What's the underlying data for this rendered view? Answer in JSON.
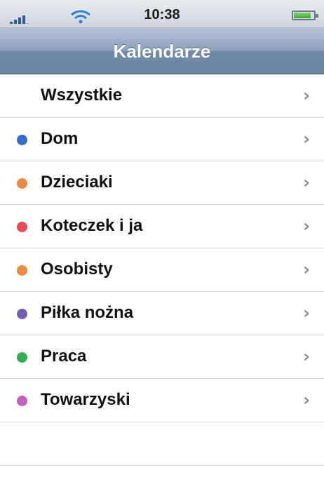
{
  "status_bar": {
    "time": "10:38",
    "signal_icon": "signal-bars-icon",
    "wifi_icon": "wifi-icon",
    "battery_icon": "battery-icon",
    "battery_color": "#4cb83a"
  },
  "nav_bar": {
    "title": "Kalendarze"
  },
  "calendars": [
    {
      "label": "Wszystkie",
      "color": null
    },
    {
      "label": "Dom",
      "color": "#2f6fd0"
    },
    {
      "label": "Dzieciaki",
      "color": "#f08a3c"
    },
    {
      "label": "Koteczek i ja",
      "color": "#e84b55"
    },
    {
      "label": "Osobisty",
      "color": "#f08a3c"
    },
    {
      "label": "Piłka nożna",
      "color": "#7a5cb3"
    },
    {
      "label": "Praca",
      "color": "#2fb14c"
    },
    {
      "label": "Towarzyski",
      "color": "#c45fbf"
    }
  ],
  "chevron_glyph": "›",
  "chevron_icon": "chevron-right-icon"
}
